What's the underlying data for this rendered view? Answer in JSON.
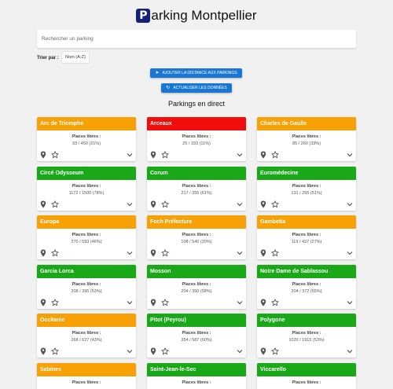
{
  "header": {
    "logo_letter": "P",
    "title": "arking Montpellier"
  },
  "search": {
    "placeholder": "Rechercher un parking",
    "value": ""
  },
  "sort": {
    "label": "Trier par :",
    "value": "Nom (A-Z)"
  },
  "actions": {
    "distance_label": "Ajouter la distance aux parkings",
    "refresh_label": "Actualiser les données"
  },
  "section_title": "Parkings en direct",
  "colors": {
    "orange": "#f7a107",
    "red": "#f20d0d",
    "green": "#18a818",
    "button_blue": "#1976d2",
    "logo_navy": "#14207a"
  },
  "card_free_label": "Places libres :",
  "parkings": [
    {
      "name": "Arc de Triomphe",
      "places": "93 / 450 (21%)",
      "status": "orange"
    },
    {
      "name": "Arceaux",
      "places": "25 / 333 (11%)",
      "status": "red"
    },
    {
      "name": "Charles de Gaulle",
      "places": "85 / 260 (33%)",
      "status": "orange"
    },
    {
      "name": "Circé Odysseum",
      "places": "1172 / 1500 (78%)",
      "status": "green"
    },
    {
      "name": "Corum",
      "places": "217 / 355 (61%)",
      "status": "green"
    },
    {
      "name": "Euromédecine",
      "places": "131 / 255 (51%)",
      "status": "green"
    },
    {
      "name": "Europa",
      "places": "270 / 593 (46%)",
      "status": "orange"
    },
    {
      "name": "Foch Préfecture",
      "places": "108 / 540 (20%)",
      "status": "orange"
    },
    {
      "name": "Gambetta",
      "places": "119 / 437 (27%)",
      "status": "orange"
    },
    {
      "name": "Garcia Lorca",
      "places": "208 / 395 (53%)",
      "status": "green"
    },
    {
      "name": "Mosson",
      "places": "204 / 350 (58%)",
      "status": "green"
    },
    {
      "name": "Notre Dame de Sablassou",
      "places": "204 / 372 (55%)",
      "status": "green"
    },
    {
      "name": "Occitanie",
      "places": "268 / 627 (43%)",
      "status": "orange"
    },
    {
      "name": "Pitot (Peyrou)",
      "places": "354 / 587 (60%)",
      "status": "green"
    },
    {
      "name": "Polygone",
      "places": "1020 / 1915 (53%)",
      "status": "green"
    },
    {
      "name": "Sabines",
      "places": "",
      "status": "orange"
    },
    {
      "name": "Saint-Jean-le-Sec",
      "places": "",
      "status": "green"
    },
    {
      "name": "Viccarello",
      "places": "",
      "status": "green"
    }
  ]
}
